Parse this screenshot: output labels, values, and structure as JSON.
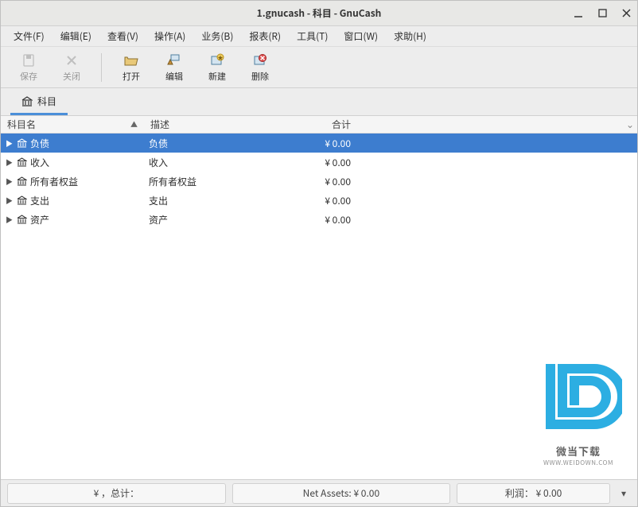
{
  "titlebar": {
    "title": "1.gnucash - 科目 - GnuCash"
  },
  "menubar": {
    "items": [
      "文件(F)",
      "编辑(E)",
      "查看(V)",
      "操作(A)",
      "业务(B)",
      "报表(R)",
      "工具(T)",
      "窗口(W)",
      "求助(H)"
    ]
  },
  "toolbar": {
    "save": "保存",
    "close": "关闭",
    "open": "打开",
    "edit": "编辑",
    "new": "新建",
    "delete": "删除"
  },
  "tab": {
    "label": "科目"
  },
  "columns": {
    "name": "科目名",
    "desc": "描述",
    "total": "合计"
  },
  "accounts": [
    {
      "name": "负债",
      "desc": "负债",
      "total": "¥ 0.00",
      "selected": true
    },
    {
      "name": "收入",
      "desc": "收入",
      "total": "¥ 0.00",
      "selected": false
    },
    {
      "name": "所有者权益",
      "desc": "所有者权益",
      "total": "¥ 0.00",
      "selected": false
    },
    {
      "name": "支出",
      "desc": "支出",
      "total": "¥ 0.00",
      "selected": false
    },
    {
      "name": "资产",
      "desc": "资产",
      "total": "¥ 0.00",
      "selected": false
    }
  ],
  "statusbar": {
    "currency_total": "¥ ，总计：",
    "net_assets": "Net Assets: ¥ 0.00",
    "profit": "利润： ¥ 0.00"
  },
  "watermark": {
    "main": "微当下载",
    "sub": "WWW.WEIDOWN.COM"
  }
}
